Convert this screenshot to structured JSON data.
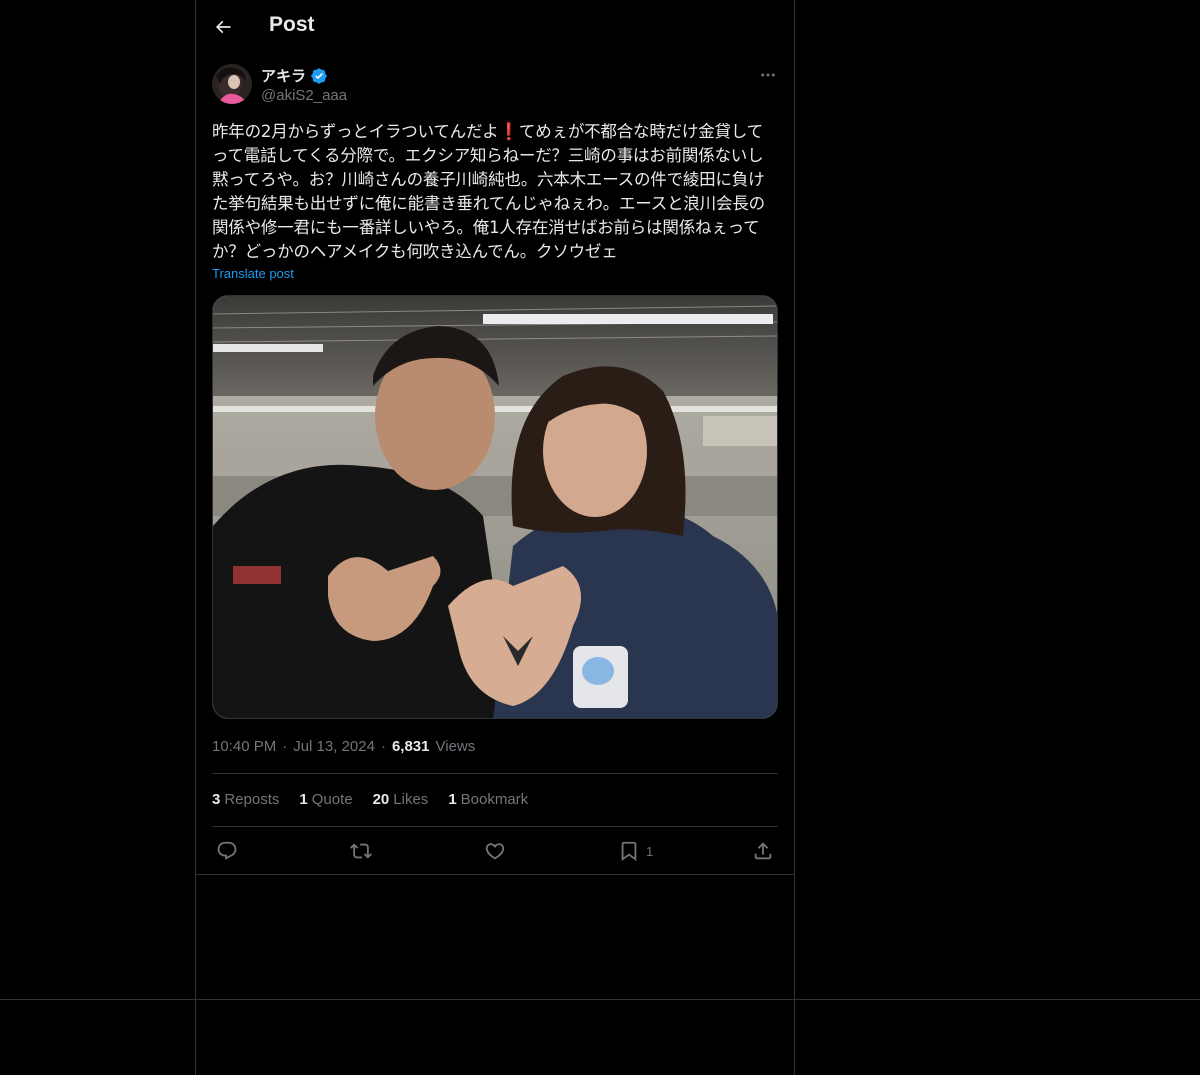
{
  "header": {
    "title": "Post",
    "back_icon": "arrow-left-icon"
  },
  "author": {
    "display_name": "アキラ",
    "handle": "@akiS2_aaa",
    "verified": true,
    "verified_color": "#1d9bf0"
  },
  "post": {
    "text": "昨年の2月からずっとイラついてんだよ❗️てめぇが不都合な時だけ金貸してって電話してくる分際で。エクシア知らねーだ？三崎の事はお前関係ないし黙ってろや。お？川崎さんの養子川崎純也。六本木エースの件で綾田に負けた挙句結果も出せずに俺に能書き垂れてんじゃねぇわ。エースと浪川会長の関係や修一君にも一番詳しいやろ。俺1人存在消せばお前らは関係ねぇってか？どっかのヘアメイクも何吹き込んでん。クソウゼェ",
    "translate_label": "Translate post",
    "photo_description": "photo"
  },
  "meta": {
    "time": "10:40 PM",
    "separator": "·",
    "date": "Jul 13, 2024",
    "views_count": "6,831",
    "views_label": "Views"
  },
  "stats": [
    {
      "count": "3",
      "label": "Reposts"
    },
    {
      "count": "1",
      "label": "Quote"
    },
    {
      "count": "20",
      "label": "Likes"
    },
    {
      "count": "1",
      "label": "Bookmark"
    }
  ],
  "actions": {
    "reply_icon": "reply-icon",
    "repost_icon": "repost-icon",
    "like_icon": "heart-icon",
    "bookmark_icon": "bookmark-icon",
    "bookmark_count": "1",
    "share_icon": "share-icon"
  },
  "colors": {
    "background": "#000000",
    "text": "#e7e9ea",
    "muted": "#71767b",
    "border": "#2f3336",
    "link": "#1d9bf0"
  }
}
